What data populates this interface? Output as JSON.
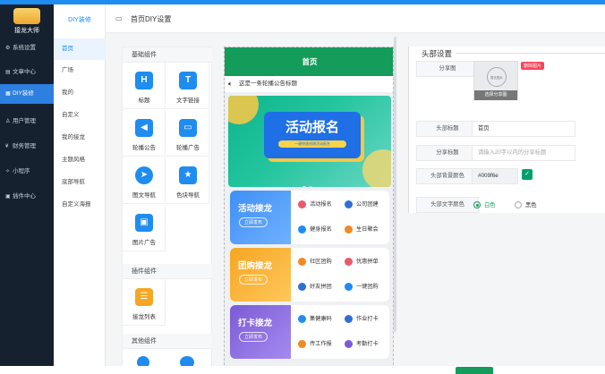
{
  "app": {
    "name": "接龙大师"
  },
  "nav": [
    {
      "icon": "gear-icon",
      "label": "系统设置"
    },
    {
      "icon": "document-icon",
      "label": "文章中心"
    },
    {
      "icon": "diy-icon",
      "label": "DIY装修",
      "active": true
    },
    {
      "icon": "user-icon",
      "label": "用户管理"
    },
    {
      "icon": "money-icon",
      "label": "财务管理"
    },
    {
      "icon": "miniapp-icon",
      "label": "小程序"
    },
    {
      "icon": "plugin-icon",
      "label": "插件中心"
    }
  ],
  "subnav": {
    "title": "DIY装修",
    "items": [
      "首页",
      "广场",
      "我的",
      "自定义",
      "我的接龙",
      "主题风格",
      "底部导航",
      "自定义海报"
    ]
  },
  "header": {
    "title": "首页DIY设置"
  },
  "components": {
    "basic": {
      "title": "基础组件",
      "items": [
        {
          "label": "标题",
          "glyph": "H"
        },
        {
          "label": "文字链接",
          "glyph": "T"
        },
        {
          "label": "轮播公告",
          "glyph": "◀"
        },
        {
          "label": "轮播广告",
          "glyph": "▭"
        },
        {
          "label": "图文导航",
          "glyph": "➤"
        },
        {
          "label": "色块导航",
          "glyph": "★"
        },
        {
          "label": "图片广告",
          "glyph": "▣"
        }
      ]
    },
    "plugin": {
      "title": "插件组件",
      "items": [
        {
          "label": "接龙列表",
          "glyph": "☰"
        }
      ]
    },
    "other": {
      "title": "其他组件"
    }
  },
  "preview": {
    "header": "首页",
    "notice": "这是一条轮播公告标题",
    "banner": {
      "title": "活动报名",
      "subtitle": "一键快速创建活动报名"
    },
    "cards": [
      {
        "title": "活动接龙",
        "btn": "立即发布",
        "color": "#3f8ff5",
        "items": [
          {
            "t": "活动报名",
            "c": "#e85a6a"
          },
          {
            "t": "公司团建",
            "c": "#2f6fd6"
          },
          {
            "t": "健身报名",
            "c": "#1f8cf0"
          },
          {
            "t": "生日聚会",
            "c": "#f08a24"
          }
        ]
      },
      {
        "title": "团购接龙",
        "btn": "立即发布",
        "color": "#f5a623",
        "items": [
          {
            "t": "社区团购",
            "c": "#f08a24"
          },
          {
            "t": "优惠拼单",
            "c": "#e85a6a"
          },
          {
            "t": "好友拼团",
            "c": "#2f6fd6"
          },
          {
            "t": "一键团购",
            "c": "#1f8cf0"
          }
        ]
      },
      {
        "title": "打卡接龙",
        "btn": "立即发布",
        "color": "#7b5bd6",
        "items": [
          {
            "t": "集健康码",
            "c": "#1f8cf0"
          },
          {
            "t": "作业打卡",
            "c": "#2f6fd6"
          },
          {
            "t": "传工作报",
            "c": "#f08a24"
          },
          {
            "t": "考勤打卡",
            "c": "#7b5bd6"
          }
        ]
      }
    ]
  },
  "settings": {
    "title": "头部设置",
    "share_image_label": "分享图",
    "image_placeholder": "暂无图片",
    "choose_btn": "选择分享图",
    "delete_btn": "删除图片",
    "header_title_label": "头部标题",
    "header_title_value": "首页",
    "share_title_label": "分享标题",
    "share_title_placeholder": "请输入20字以内的分享标题",
    "bg_color_label": "头部背景颜色",
    "bg_color_value": "#009f6e",
    "text_color_label": "头部文字颜色",
    "text_color_options": [
      "白色",
      "黑色"
    ],
    "text_color_selected": "白色"
  }
}
